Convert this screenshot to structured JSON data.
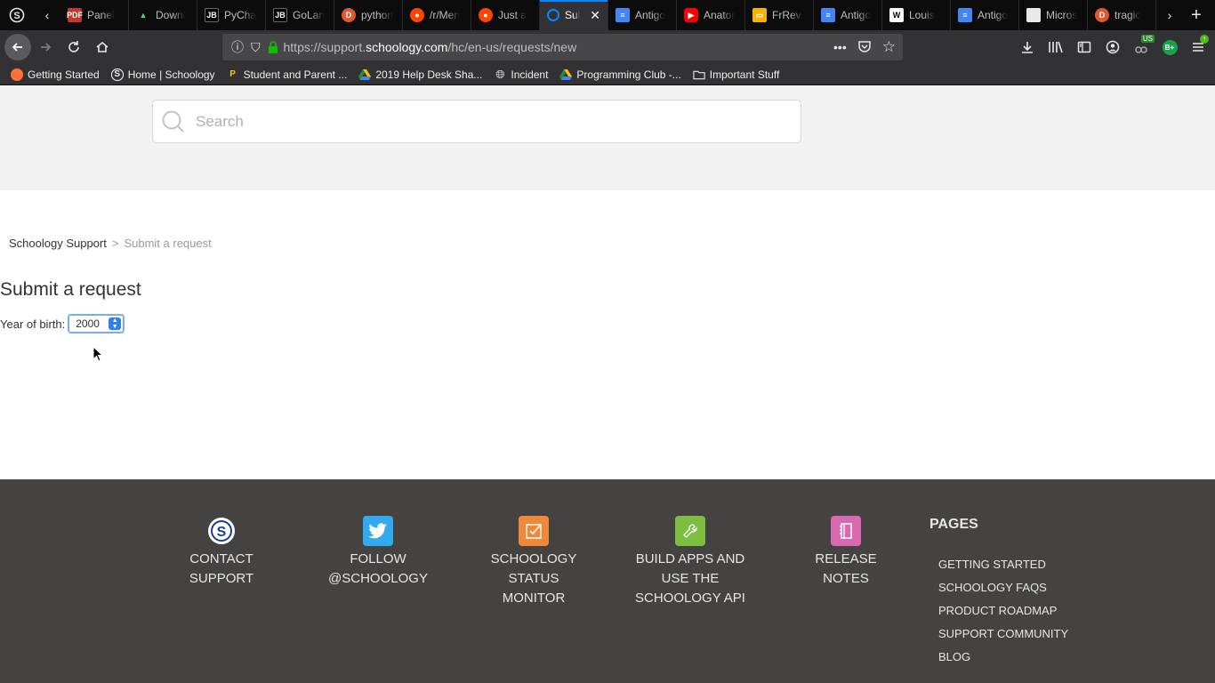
{
  "browser": {
    "tabs": [
      {
        "label": "",
        "icon": "schoology-s-icon"
      },
      {
        "label": "Panel",
        "icon": "pdf-icon"
      },
      {
        "label": "Downl",
        "icon": "android-icon"
      },
      {
        "label": "PyCha",
        "icon": "jetbrains-icon"
      },
      {
        "label": "GoLan",
        "icon": "jetbrains-icon"
      },
      {
        "label": "python",
        "icon": "duckduckgo-icon"
      },
      {
        "label": "/r/Men",
        "icon": "reddit-icon"
      },
      {
        "label": "Just a",
        "icon": "reddit-icon"
      },
      {
        "label": "Sul",
        "icon": "loading-icon"
      },
      {
        "label": "Antigo",
        "icon": "docs-icon"
      },
      {
        "label": "Anator",
        "icon": "youtube-icon"
      },
      {
        "label": "FrRev.",
        "icon": "slides-icon"
      },
      {
        "label": "Antigo",
        "icon": "docs-icon"
      },
      {
        "label": "Louis",
        "icon": "wikipedia-icon"
      },
      {
        "label": "Antigo",
        "icon": "docs-icon"
      },
      {
        "label": "Micros",
        "icon": "blank-page-icon"
      },
      {
        "label": "tragic",
        "icon": "duckduckgo-icon"
      }
    ],
    "url": {
      "prefix": "https://support.",
      "domain": "schoology.com",
      "path": "/hc/en-us/requests/new"
    },
    "bookmarks": [
      {
        "label": "Getting Started",
        "icon": "firefox-icon"
      },
      {
        "label": "Home | Schoology",
        "icon": "schoology-s-icon"
      },
      {
        "label": "Student and Parent ...",
        "icon": "p-icon"
      },
      {
        "label": "2019 Help Desk Sha...",
        "icon": "drive-icon"
      },
      {
        "label": "Incident",
        "icon": "globe-icon"
      },
      {
        "label": "Programming Club -...",
        "icon": "drive-icon"
      },
      {
        "label": "Important Stuff",
        "icon": "folder-icon"
      }
    ],
    "extension_badge": "US",
    "extension_b": "B+"
  },
  "page": {
    "search_placeholder": "Search",
    "breadcrumb": {
      "root": "Schoology Support",
      "separator": ">",
      "current": "Submit a request"
    },
    "title": "Submit a request",
    "year_label": "Year of birth:",
    "year_value": "2000"
  },
  "footer": {
    "columns": [
      {
        "label1": "CONTACT",
        "label2": "SUPPORT",
        "label3": "",
        "icon": "schoology-s-icon",
        "color": "#ffffff"
      },
      {
        "label1": "FOLLOW",
        "label2": "@SCHOOLOGY",
        "label3": "",
        "icon": "twitter-icon",
        "color": "#33aaf0"
      },
      {
        "label1": "SCHOOLOGY",
        "label2": "STATUS",
        "label3": "MONITOR",
        "icon": "status-check-icon",
        "color": "#f0883a"
      },
      {
        "label1": "BUILD APPS AND",
        "label2": "USE THE",
        "label3": "SCHOOLOGY API",
        "icon": "wrench-icon",
        "color": "#7cbd42"
      },
      {
        "label1": "RELEASE",
        "label2": "NOTES",
        "label3": "",
        "icon": "notebook-icon",
        "color": "#d96ab2"
      }
    ],
    "pages_title": "PAGES",
    "pages": [
      "GETTING STARTED",
      "SCHOOLOGY FAQS",
      "PRODUCT ROADMAP",
      "SUPPORT COMMUNITY",
      "BLOG"
    ]
  }
}
